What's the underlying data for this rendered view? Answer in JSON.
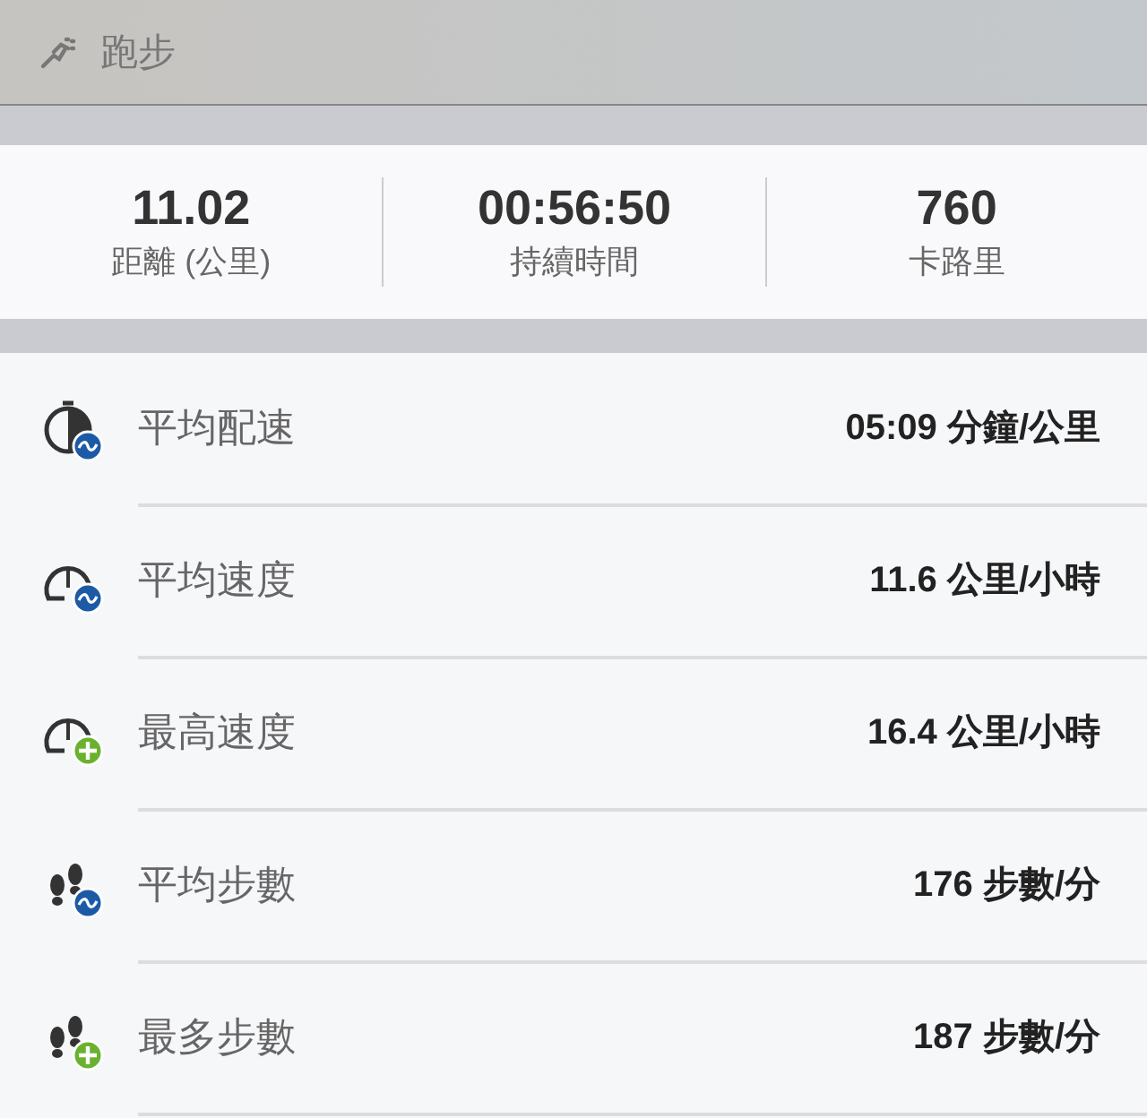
{
  "header": {
    "title": "跑步"
  },
  "summary": [
    {
      "value": "11.02",
      "label": "距離 (公里)"
    },
    {
      "value": "00:56:50",
      "label": "持續時間"
    },
    {
      "value": "760",
      "label": "卡路里"
    }
  ],
  "metrics": [
    {
      "kind": "avgpace",
      "label": "平均配速",
      "value": "05:09 分鐘/公里"
    },
    {
      "kind": "avgspeed",
      "label": "平均速度",
      "value": "11.6 公里/小時"
    },
    {
      "kind": "maxspeed",
      "label": "最高速度",
      "value": "16.4 公里/小時"
    },
    {
      "kind": "avgsteps",
      "label": "平均步數",
      "value": "176 步數/分"
    },
    {
      "kind": "maxsteps",
      "label": "最多步數",
      "value": "187 步數/分"
    }
  ]
}
